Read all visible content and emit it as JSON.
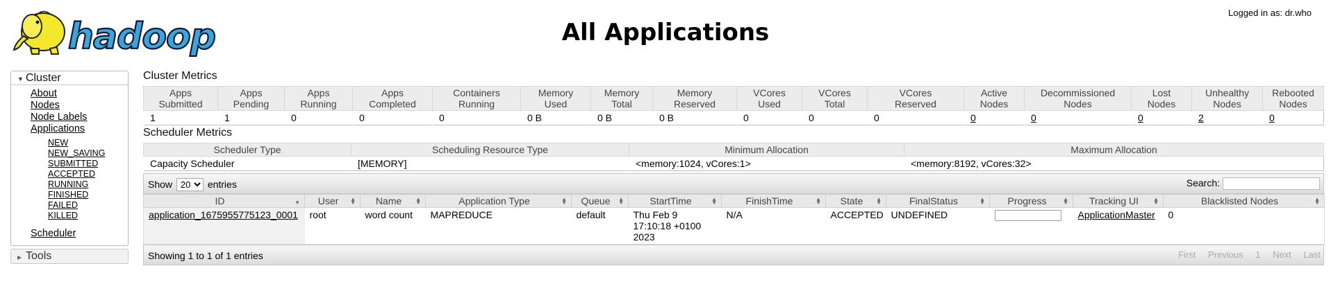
{
  "header": {
    "title": "All Applications",
    "logged_in_as": "Logged in as: dr.who",
    "logo_text": "hadoop"
  },
  "nav": {
    "cluster_label": "Cluster",
    "items": [
      {
        "label": "About"
      },
      {
        "label": "Nodes"
      },
      {
        "label": "Node Labels"
      },
      {
        "label": "Applications"
      }
    ],
    "app_states": [
      "NEW",
      "NEW_SAVING",
      "SUBMITTED",
      "ACCEPTED",
      "RUNNING",
      "FINISHED",
      "FAILED",
      "KILLED"
    ],
    "scheduler_label": "Scheduler",
    "tools_label": "Tools"
  },
  "cluster_metrics": {
    "title": "Cluster Metrics",
    "headers": [
      [
        "Apps",
        "Submitted"
      ],
      [
        "Apps",
        "Pending"
      ],
      [
        "Apps",
        "Running"
      ],
      [
        "Apps",
        "Completed"
      ],
      [
        "Containers",
        "Running"
      ],
      [
        "Memory",
        "Used"
      ],
      [
        "Memory",
        "Total"
      ],
      [
        "Memory",
        "Reserved"
      ],
      [
        "VCores",
        "Used"
      ],
      [
        "VCores",
        "Total"
      ],
      [
        "VCores",
        "Reserved"
      ],
      [
        "Active",
        "Nodes"
      ],
      [
        "Decommissioned",
        "Nodes"
      ],
      [
        "Lost",
        "Nodes"
      ],
      [
        "Unhealthy",
        "Nodes"
      ],
      [
        "Rebooted",
        "Nodes"
      ]
    ],
    "values": [
      "1",
      "1",
      "0",
      "0",
      "0",
      "0 B",
      "0 B",
      "0 B",
      "0",
      "0",
      "0",
      "0",
      "0",
      "0",
      "2",
      "0"
    ]
  },
  "scheduler_metrics": {
    "title": "Scheduler Metrics",
    "headers": [
      "Scheduler Type",
      "Scheduling Resource Type",
      "Minimum Allocation",
      "Maximum Allocation"
    ],
    "values": [
      "Capacity Scheduler",
      "[MEMORY]",
      "<memory:1024, vCores:1>",
      "<memory:8192, vCores:32>"
    ]
  },
  "apps_table": {
    "show_label": "Show",
    "entries_label": "entries",
    "page_size": "20",
    "page_size_options": [
      "20"
    ],
    "search_label": "Search:",
    "search_value": "",
    "columns": [
      "ID",
      "User",
      "Name",
      "Application Type",
      "Queue",
      "StartTime",
      "FinishTime",
      "State",
      "FinalStatus",
      "Progress",
      "Tracking UI",
      "Blacklisted Nodes"
    ],
    "rows": [
      {
        "id": "application_1675955775123_0001",
        "user": "root",
        "name": "word count",
        "app_type": "MAPREDUCE",
        "queue": "default",
        "start_time": "Thu Feb 9 17:10:18 +0100 2023",
        "finish_time": "N/A",
        "state": "ACCEPTED",
        "final_status": "UNDEFINED",
        "progress": 0,
        "tracking_ui": "ApplicationMaster",
        "blacklisted_nodes": "0"
      }
    ],
    "info": "Showing 1 to 1 of 1 entries",
    "pager": {
      "first": "First",
      "previous": "Previous",
      "page": "1",
      "next": "Next",
      "last": "Last"
    }
  },
  "colors": {
    "logo_yellow": "#f4e82c",
    "logo_blue": "#3ea3d8",
    "progress_fill": "#3a8c3a"
  }
}
